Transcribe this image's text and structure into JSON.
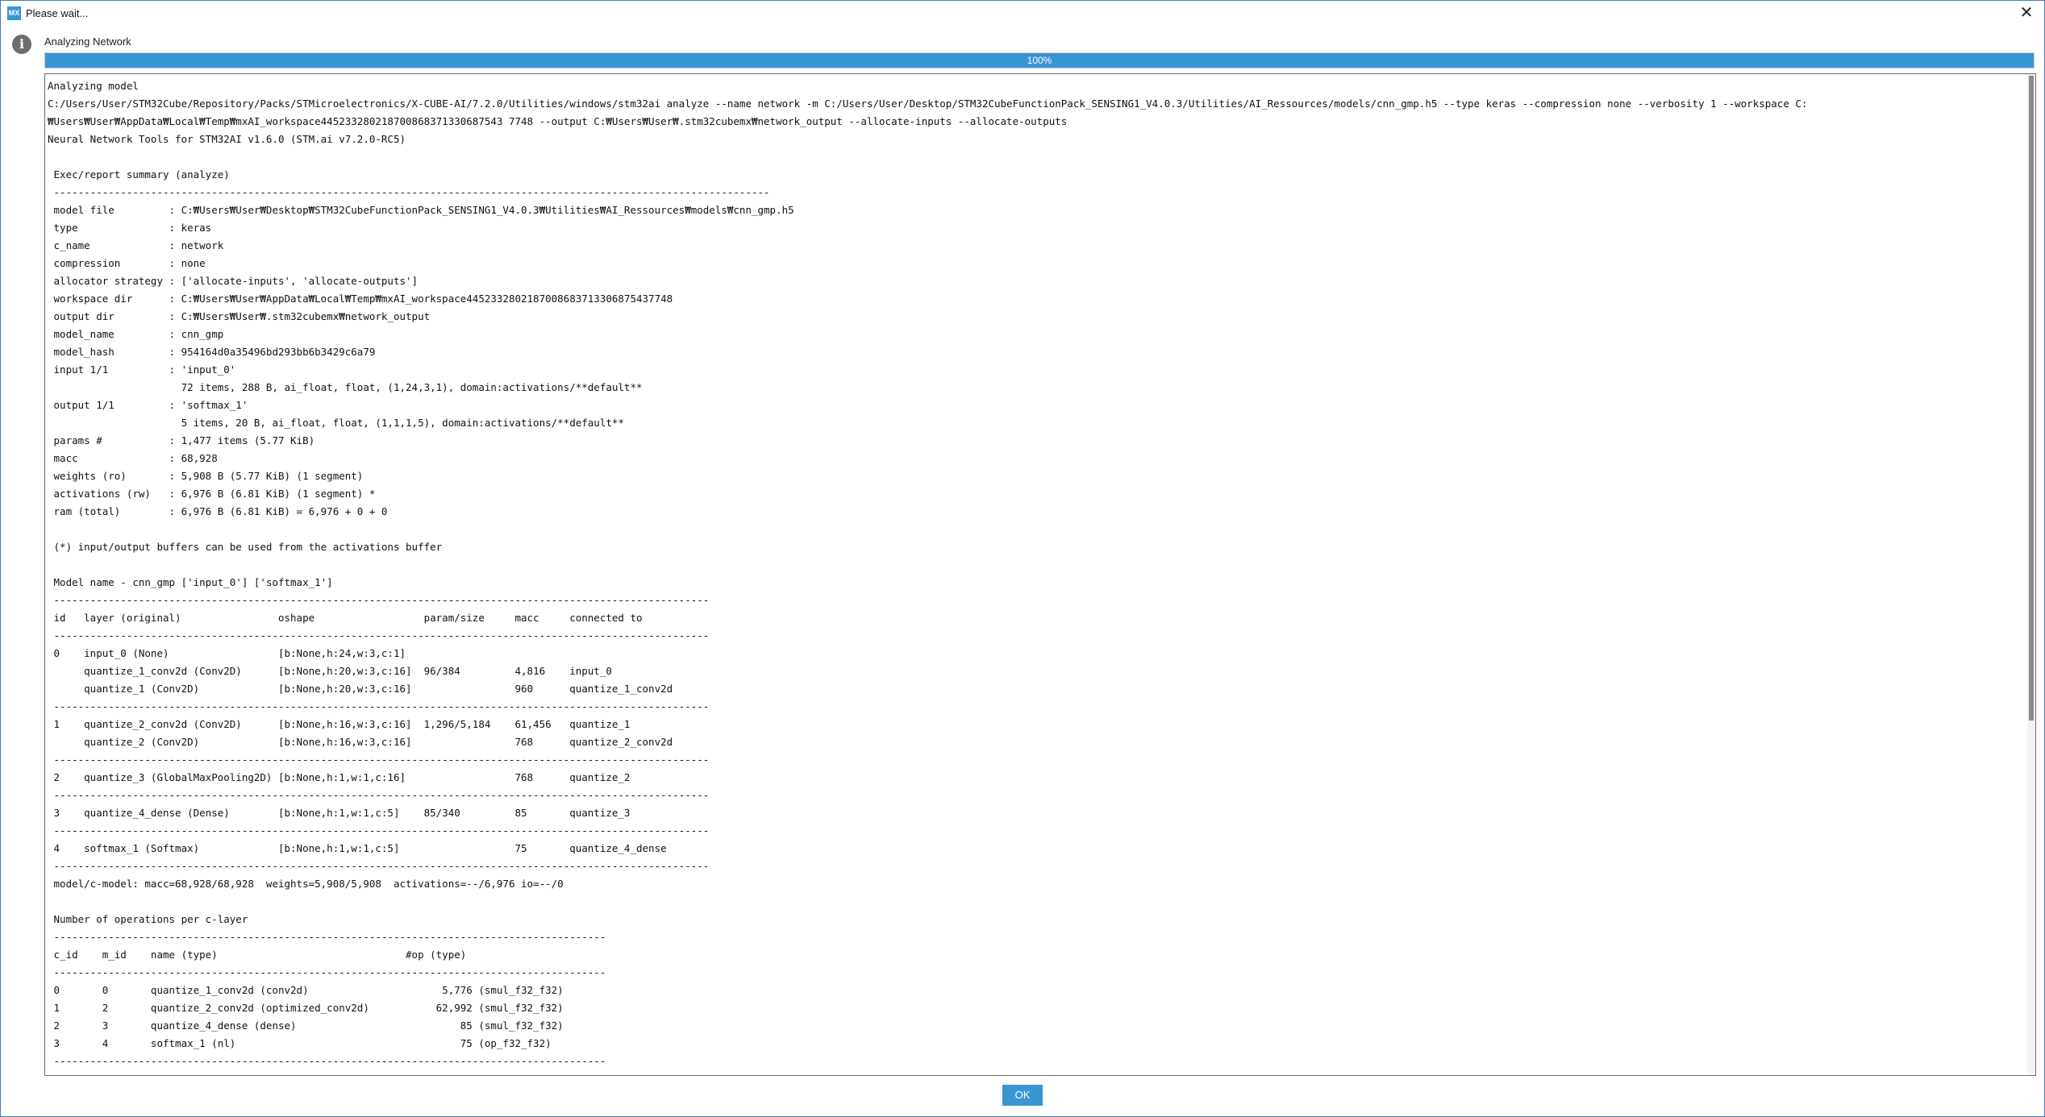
{
  "window": {
    "title": "Please wait...",
    "icon_text": "MX",
    "close_glyph": "✕"
  },
  "status": {
    "icon": "info-icon",
    "icon_glyph": "i",
    "label": "Analyzing Network"
  },
  "progress": {
    "value": 100,
    "label": "100%"
  },
  "log": {
    "lines": [
      "Analyzing model",
      "C:/Users/User/STM32Cube/Repository/Packs/STMicroelectronics/X-CUBE-AI/7.2.0/Utilities/windows/stm32ai analyze --name network -m C:/Users/User/Desktop/STM32CubeFunctionPack_SENSING1_V4.0.3/Utilities/AI_Ressources/models/cnn_gmp.h5 --type keras --compression none --verbosity 1 --workspace C:",
      "₩Users₩User₩AppData₩Local₩Temp₩mxAI_workspace445233280218700868371330687543 7748 --output C:₩Users₩User₩.stm32cubemx₩network_output --allocate-inputs --allocate-outputs",
      "Neural Network Tools for STM32AI v1.6.0 (STM.ai v7.2.0-RC5)",
      "",
      " Exec/report summary (analyze)",
      " ----------------------------------------------------------------------------------------------------------------------",
      " model file         : C:₩Users₩User₩Desktop₩STM32CubeFunctionPack_SENSING1_V4.0.3₩Utilities₩AI_Ressources₩models₩cnn_gmp.h5",
      " type               : keras",
      " c_name             : network",
      " compression        : none",
      " allocator strategy : ['allocate-inputs', 'allocate-outputs']",
      " workspace dir      : C:₩Users₩User₩AppData₩Local₩Temp₩mxAI_workspace4452332802187008683713306875437748",
      " output dir         : C:₩Users₩User₩.stm32cubemx₩network_output",
      " model_name         : cnn_gmp",
      " model_hash         : 954164d0a35496bd293bb6b3429c6a79",
      " input 1/1          : 'input_0'",
      "                      72 items, 288 B, ai_float, float, (1,24,3,1), domain:activations/**default**",
      " output 1/1         : 'softmax_1'",
      "                      5 items, 20 B, ai_float, float, (1,1,1,5), domain:activations/**default**",
      " params #           : 1,477 items (5.77 KiB)",
      " macc               : 68,928",
      " weights (ro)       : 5,908 B (5.77 KiB) (1 segment)",
      " activations (rw)   : 6,976 B (6.81 KiB) (1 segment) *",
      " ram (total)        : 6,976 B (6.81 KiB) = 6,976 + 0 + 0",
      "",
      " (*) input/output buffers can be used from the activations buffer",
      "",
      " Model name - cnn_gmp ['input_0'] ['softmax_1']",
      " ------------------------------------------------------------------------------------------------------------",
      " id   layer (original)                oshape                  param/size     macc     connected to",
      " ------------------------------------------------------------------------------------------------------------",
      " 0    input_0 (None)                  [b:None,h:24,w:3,c:1]",
      "      quantize_1_conv2d (Conv2D)      [b:None,h:20,w:3,c:16]  96/384         4,816    input_0",
      "      quantize_1 (Conv2D)             [b:None,h:20,w:3,c:16]                 960      quantize_1_conv2d",
      " ------------------------------------------------------------------------------------------------------------",
      " 1    quantize_2_conv2d (Conv2D)      [b:None,h:16,w:3,c:16]  1,296/5,184    61,456   quantize_1",
      "      quantize_2 (Conv2D)             [b:None,h:16,w:3,c:16]                 768      quantize_2_conv2d",
      " ------------------------------------------------------------------------------------------------------------",
      " 2    quantize_3 (GlobalMaxPooling2D) [b:None,h:1,w:1,c:16]                  768      quantize_2",
      " ------------------------------------------------------------------------------------------------------------",
      " 3    quantize_4_dense (Dense)        [b:None,h:1,w:1,c:5]    85/340         85       quantize_3",
      " ------------------------------------------------------------------------------------------------------------",
      " 4    softmax_1 (Softmax)             [b:None,h:1,w:1,c:5]                   75       quantize_4_dense",
      " ------------------------------------------------------------------------------------------------------------",
      " model/c-model: macc=68,928/68,928  weights=5,908/5,908  activations=--/6,976 io=--/0",
      "",
      " Number of operations per c-layer",
      " -------------------------------------------------------------------------------------------",
      " c_id    m_id    name (type)                               #op (type)",
      " -------------------------------------------------------------------------------------------",
      " 0       0       quantize_1_conv2d (conv2d)                      5,776 (smul_f32_f32)",
      " 1       2       quantize_2_conv2d (optimized_conv2d)           62,992 (smul_f32_f32)",
      " 2       3       quantize_4_dense (dense)                           85 (smul_f32_f32)",
      " 3       4       softmax_1 (nl)                                     75 (op_f32_f32)",
      " -------------------------------------------------------------------------------------------"
    ]
  },
  "buttons": {
    "ok_label": "OK"
  },
  "colors": {
    "accent": "#3a95d3",
    "window_border": "#4a7ab5",
    "info_icon": "#6d6d6d"
  }
}
